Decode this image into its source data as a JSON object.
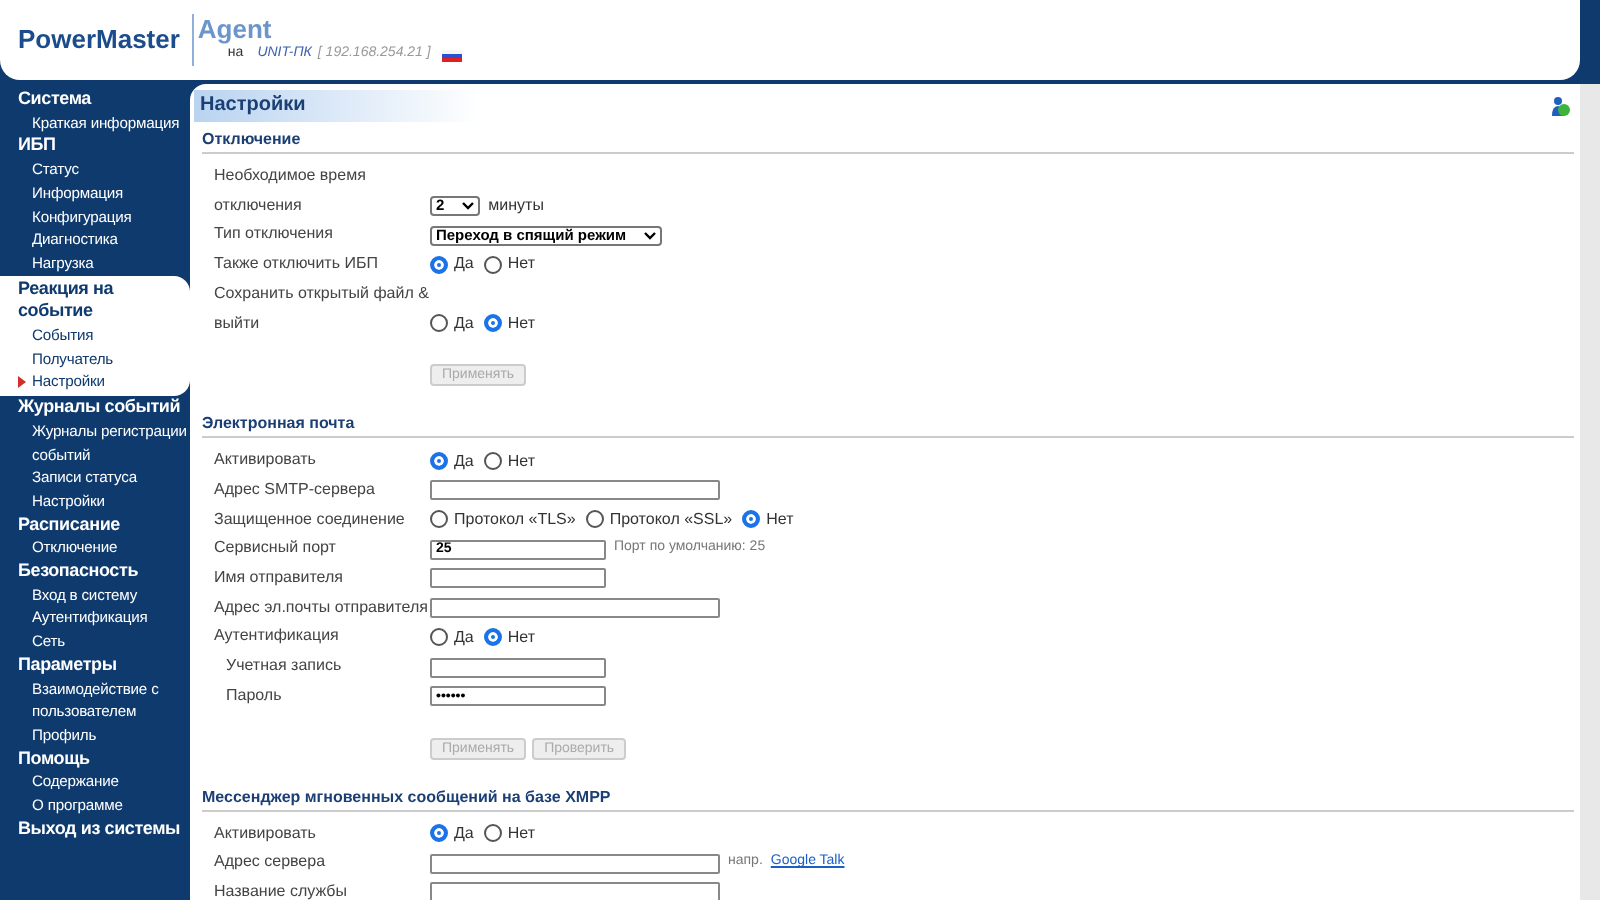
{
  "header": {
    "logo": "PowerMaster",
    "product": "Agent",
    "on": "на",
    "host": "UNIT-ПК",
    "address": "[ 192.168.254.21 ]"
  },
  "sidebar": [
    {
      "title": "Система",
      "selected": false,
      "items": [
        {
          "label": "Краткая информация",
          "selected": false
        }
      ]
    },
    {
      "title": "ИБП",
      "selected": false,
      "items": [
        {
          "label": "Статус",
          "selected": false
        },
        {
          "label": "Информация",
          "selected": false
        },
        {
          "label": "Конфигурация",
          "selected": false
        },
        {
          "label": "Диагностика",
          "selected": false
        },
        {
          "label": "Нагрузка",
          "selected": false
        }
      ]
    },
    {
      "title": "Реакция на событие",
      "selected": true,
      "items": [
        {
          "label": "События",
          "selected": false
        },
        {
          "label": "Получатель",
          "selected": false
        },
        {
          "label": "Настройки",
          "selected": true
        }
      ]
    },
    {
      "title": "Журналы событий",
      "selected": false,
      "items": [
        {
          "label": "Журналы регистрации событий",
          "selected": false
        },
        {
          "label": "Записи статуса",
          "selected": false
        },
        {
          "label": "Настройки",
          "selected": false
        }
      ]
    },
    {
      "title": "Расписание",
      "selected": false,
      "items": [
        {
          "label": "Отключение",
          "selected": false
        }
      ]
    },
    {
      "title": "Безопасность",
      "selected": false,
      "items": [
        {
          "label": "Вход в систему",
          "selected": false
        },
        {
          "label": "Аутентификация",
          "selected": false
        },
        {
          "label": "Сеть",
          "selected": false
        }
      ]
    },
    {
      "title": "Параметры",
      "selected": false,
      "items": [
        {
          "label": "Взаимодействие с пользователем",
          "selected": false
        },
        {
          "label": "Профиль",
          "selected": false
        }
      ]
    },
    {
      "title": "Помощь",
      "selected": false,
      "items": [
        {
          "label": "Содержание",
          "selected": false
        },
        {
          "label": "О программе",
          "selected": false
        }
      ]
    },
    {
      "title": "Выход из системы",
      "selected": false
    }
  ],
  "page_title": "Настройки",
  "sections": [
    {
      "title": "Отключение",
      "rows": [
        {
          "kind": "select",
          "label": "Необходимое время отключения",
          "value": "2",
          "suffix": "минуты"
        },
        {
          "kind": "select",
          "label": "Тип отключения",
          "value": "Переход в спящий режим"
        },
        {
          "kind": "radio",
          "label": "Также отключить ИБП",
          "options": [
            {
              "label": "Да",
              "selected": true
            },
            {
              "label": "Нет",
              "selected": false
            }
          ]
        },
        {
          "kind": "radio",
          "label": "Сохранить открытый файл & выйти",
          "options": [
            {
              "label": "Да",
              "selected": false
            },
            {
              "label": "Нет",
              "selected": true
            }
          ]
        }
      ],
      "buttons": [
        {
          "label": "Применять",
          "disabled": true
        }
      ]
    },
    {
      "title": "Электронная почта",
      "rows": [
        {
          "kind": "radio",
          "label": "Активировать",
          "options": [
            {
              "label": "Да",
              "selected": true
            },
            {
              "label": "Нет",
              "selected": false
            }
          ]
        },
        {
          "kind": "field",
          "label": "Адрес SMTP-сервера",
          "wide": true
        },
        {
          "kind": "radio",
          "label": "Защищенное соединение",
          "options": [
            {
              "label": "Протокол «TLS»",
              "selected": false
            },
            {
              "label": "Протокол «SSL»",
              "selected": false
            },
            {
              "label": "Нет",
              "selected": true
            }
          ]
        },
        {
          "kind": "field",
          "label": "Сервисный порт",
          "wide": false,
          "value": "25",
          "hint": "Порт по умолчанию: 25"
        },
        {
          "kind": "field",
          "label": "Имя отправителя",
          "wide": false
        },
        {
          "kind": "field",
          "label": "Адрес эл.почты отправителя",
          "wide": true
        },
        {
          "kind": "radio",
          "label": "Аутентификация",
          "options": [
            {
              "label": "Да",
              "selected": false
            },
            {
              "label": "Нет",
              "selected": true
            }
          ],
          "children": [
            {
              "kind": "field",
              "label": "Учетная запись",
              "wide": false
            },
            {
              "kind": "field",
              "label": "Пароль",
              "wide": false,
              "value": "••••••"
            }
          ]
        }
      ],
      "buttons": [
        {
          "label": "Применять",
          "disabled": true
        },
        {
          "label": "Проверить",
          "disabled": true
        }
      ]
    },
    {
      "title": "Мессенджер мгновенных сообщений на базе XMPP",
      "rows": [
        {
          "kind": "radio",
          "label": "Активировать",
          "options": [
            {
              "label": "Да",
              "selected": true
            },
            {
              "label": "Нет",
              "selected": false
            }
          ]
        },
        {
          "kind": "field",
          "label": "Адрес сервера",
          "wide": true,
          "hint": "напр.",
          "link": "Google Talk"
        },
        {
          "kind": "field",
          "label": "Название службы",
          "wide": true
        }
      ]
    }
  ]
}
